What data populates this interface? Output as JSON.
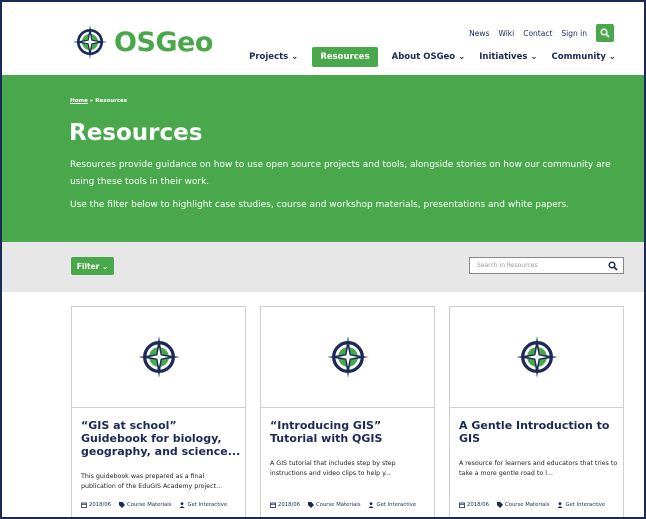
{
  "header": {
    "logo_text": "OSGeo",
    "utility_links": [
      "News",
      "Wiki",
      "Contact",
      "Sign in"
    ],
    "nav": [
      {
        "label": "Projects ⌄",
        "active": false
      },
      {
        "label": "Resources",
        "active": true
      },
      {
        "label": "About OSGeo ⌄",
        "active": false
      },
      {
        "label": "Initiatives ⌄",
        "active": false
      },
      {
        "label": "Community ⌄",
        "active": false
      }
    ]
  },
  "hero": {
    "breadcrumb_home": "Home",
    "breadcrumb_sep": " » ",
    "breadcrumb_current": "Resources",
    "title": "Resources",
    "para1": "Resources provide guidance on how to use open source projects and tools, alongside stories on how our community are using these tools in their work.",
    "para2": "Use the filter below to highlight case studies, course and workshop materials, presentations and white papers."
  },
  "filter": {
    "button_label": "Filter ⌄",
    "search_placeholder": "Search in Resources"
  },
  "cards": [
    {
      "title": "“GIS at school” Guidebook for biology, geography, and science...",
      "desc": "This guidebook was prepared as a final publication of the EduGIS Academy project...",
      "date": "2018/06",
      "tag": "Course Materials",
      "type": "Get Interactive"
    },
    {
      "title": "“Introducing GIS” Tutorial with QGIS",
      "desc": "A GIS tutorial that includes step by step instructions and video clips to help y...",
      "date": "2018/06",
      "tag": "Course Materials",
      "type": "Get Interactive"
    },
    {
      "title": "A Gentle Introduction to GIS",
      "desc": "A resource for learners and educators that tries to take a more gentle road to l...",
      "date": "2018/06",
      "tag": "Course Materials",
      "type": "Get Interactive"
    }
  ],
  "colors": {
    "brand_green": "#4aa84c",
    "navy": "#1b2a57",
    "filter_bg": "#e7e7e7"
  }
}
